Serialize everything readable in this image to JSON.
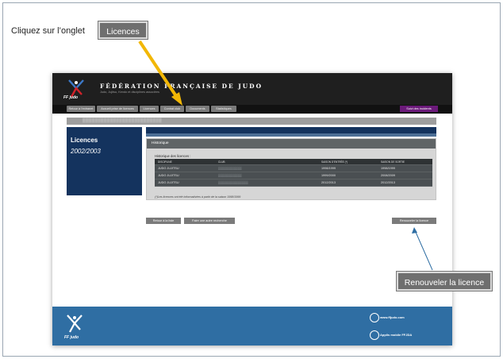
{
  "instruction": {
    "text": "Cliquez sur l’onglet",
    "tab_callout": "Licences"
  },
  "header": {
    "title": "FÉDÉRATION FRANÇAISE DE JUDO",
    "subtitle": "Judo, Jujitsu, Kendo et disciplines associées",
    "logo_text": "FF judo"
  },
  "nav": {
    "tabs": [
      "Retour à l'extranet",
      "Accueil prise de licences",
      "Licences",
      "Contrat club",
      "Documents",
      "Statistiques"
    ],
    "incidents": "Suivi des incidents"
  },
  "left_panel": {
    "title": "Licences",
    "season": "2002/2003"
  },
  "history": {
    "header": "Historique",
    "caption": "Historique des licences :",
    "columns": [
      "DISCIPLINE",
      "CLUB",
      "SAISON D'ENTRÉE (*)",
      "SAISON DE SORTIE"
    ],
    "rows": [
      {
        "discipline": "JUDO JUJITSU",
        "entry": "1998/1999",
        "exit": "1998/1999"
      },
      {
        "discipline": "JUDO JUJITSU",
        "entry": "1999/2000",
        "exit": "2008/2009"
      },
      {
        "discipline": "JUDO JUJITSU",
        "entry": "2012/2013",
        "exit": "2012/2013"
      }
    ],
    "note": "(*)Les licences ont été informatisées à partir de la saison 1998/1999"
  },
  "buttons": {
    "back": "Retour à la liste",
    "new_search": "Faire une autre recherche",
    "renew": "Renouveler la licence"
  },
  "footer": {
    "logo_text": "FF judo",
    "site_link": "www.ffjudo.com",
    "app_link": "Applis mobile FFJDA"
  },
  "callouts": {
    "renew": "Renouveler la licence"
  },
  "colors": {
    "brand_blue": "#14335e",
    "footer_blue": "#2f6ea3",
    "incidents_purple": "#6b1a7a",
    "arrow_yellow": "#f2b705"
  }
}
